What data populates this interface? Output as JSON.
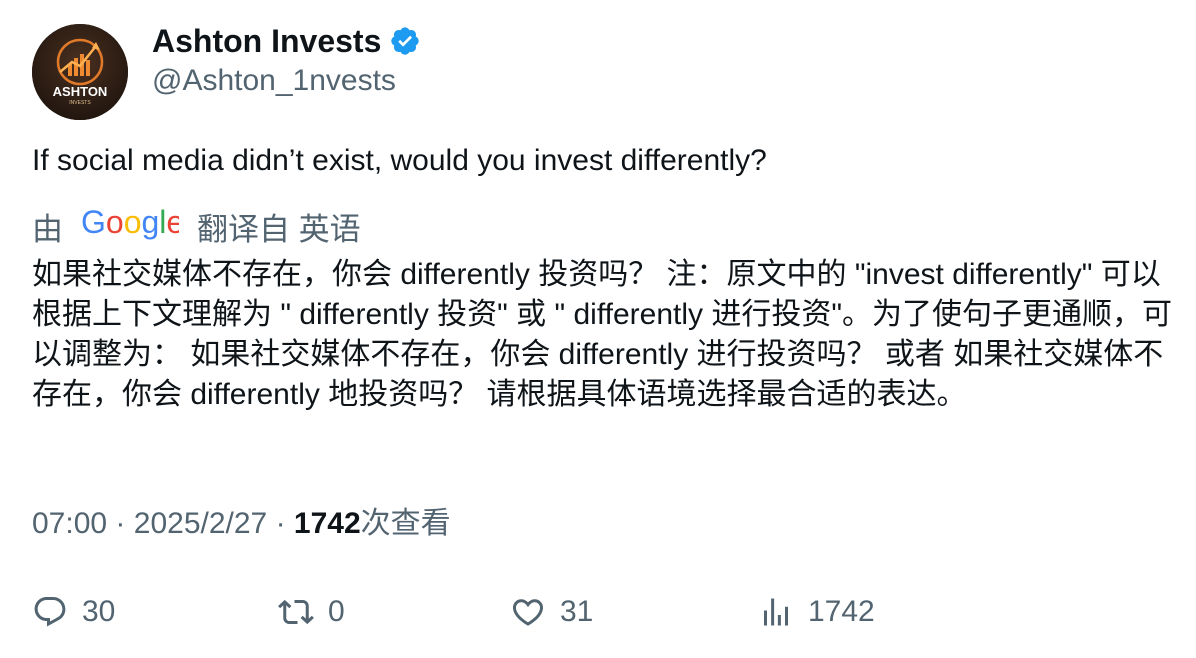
{
  "author": {
    "display_name": "Ashton Invests",
    "handle": "@Ashton_1nvests",
    "verified": true,
    "avatar_text": "ASHTON",
    "avatar_subtext": "INVESTS"
  },
  "tweet": {
    "text": "If social media didn’t exist, would you invest differently?",
    "translation": {
      "prefix": "由",
      "provider": "Google",
      "suffix": "翻译自 英语",
      "text": "如果社交媒体不存在，你会 differently 投资吗？ 注：原文中的 \"invest differently\" 可以根据上下文理解为 \" differently 投资\" 或 \" differently 进行投资\"。为了使句子更通顺，可以调整为： 如果社交媒体不存在，你会 differently 进行投资吗？ 或者 如果社交媒体不存在，你会 differently 地投资吗？ 请根据具体语境选择最合适的表达。"
    },
    "time": "07:00",
    "separator": "·",
    "date": "2025/2/27",
    "views_count": "1742",
    "views_label": "次查看"
  },
  "actions": {
    "reply": {
      "icon": "reply-icon",
      "count": "30"
    },
    "retweet": {
      "icon": "retweet-icon",
      "count": "0"
    },
    "like": {
      "icon": "heart-icon",
      "count": "31"
    },
    "views": {
      "icon": "analytics-icon",
      "count": "1742"
    }
  },
  "colors": {
    "text_primary": "#0f1419",
    "text_secondary": "#536471",
    "verified_blue": "#1d9bf0"
  }
}
